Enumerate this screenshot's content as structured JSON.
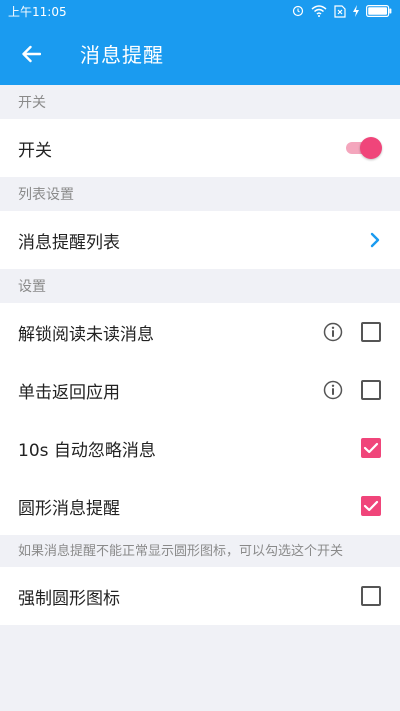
{
  "status_bar": {
    "time": "上午11:05"
  },
  "app_bar": {
    "title": "消息提醒"
  },
  "sections": {
    "switch_header": "开关",
    "switch_label": "开关",
    "switch_on": true,
    "list_header": "列表设置",
    "list_label": "消息提醒列表",
    "settings_header": "设置",
    "items": [
      {
        "label": "解锁阅读未读消息",
        "has_info": true,
        "checked": false
      },
      {
        "label": "单击返回应用",
        "has_info": true,
        "checked": false
      },
      {
        "label": "10s 自动忽略消息",
        "has_info": false,
        "checked": true
      },
      {
        "label": "圆形消息提醒",
        "has_info": false,
        "checked": true
      }
    ],
    "note": "如果消息提醒不能正常显示圆形图标，可以勾选这个开关",
    "force_label": "强制圆形图标",
    "force_checked": false
  },
  "colors": {
    "primary": "#1a9bf0",
    "accent": "#f0457a"
  },
  "icons": [
    "back-arrow-icon",
    "chevron-right-icon",
    "info-icon",
    "check-icon"
  ]
}
